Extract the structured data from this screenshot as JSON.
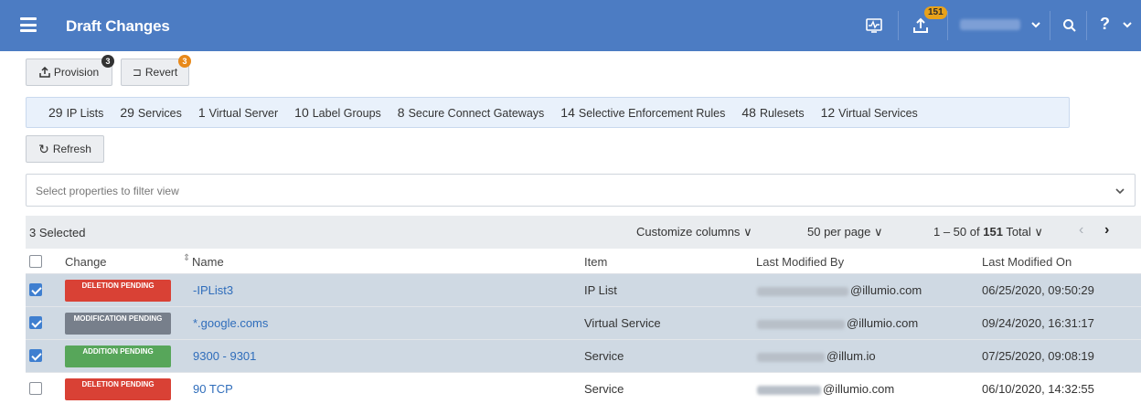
{
  "header": {
    "title": "Draft Changes",
    "pending_badge": "151",
    "icons": [
      "menu-icon",
      "monitor-icon",
      "upload-icon",
      "chevron-down-icon",
      "search-icon",
      "help-icon"
    ]
  },
  "actions": {
    "provision_label": "Provision",
    "provision_count": "3",
    "revert_label": "Revert",
    "revert_count": "3",
    "refresh_label": "Refresh"
  },
  "counts": [
    {
      "num": "29",
      "label": "IP Lists"
    },
    {
      "num": "29",
      "label": "Services"
    },
    {
      "num": "1",
      "label": "Virtual Server"
    },
    {
      "num": "10",
      "label": "Label Groups"
    },
    {
      "num": "8",
      "label": "Secure Connect Gateways"
    },
    {
      "num": "14",
      "label": "Selective Enforcement Rules"
    },
    {
      "num": "48",
      "label": "Rulesets"
    },
    {
      "num": "12",
      "label": "Virtual Services"
    }
  ],
  "filter": {
    "placeholder": "Select properties to filter view"
  },
  "toolbar": {
    "selected": "3 Selected",
    "customize": "Customize columns",
    "per_page": "50 per page",
    "range": "1 – 50 of",
    "total": "151",
    "total_label": "Total"
  },
  "table": {
    "columns": [
      "Change",
      "Name",
      "Item",
      "Last Modified By",
      "Last Modified On"
    ],
    "rows": [
      {
        "change": "DELETION PENDING",
        "status_color": "#d94135",
        "name": "-IPList3",
        "item": "IP List",
        "by_domain": "@illumio.com",
        "on": "06/25/2020, 09:50:29",
        "selected": true
      },
      {
        "change": "MODIFICATION PENDING",
        "status_color": "#777f8b",
        "name": "*.google.coms",
        "item": "Virtual Service",
        "by_domain": "@illumio.com",
        "on": "09/24/2020, 16:31:17",
        "selected": true
      },
      {
        "change": "ADDITION PENDING",
        "status_color": "#57a65a",
        "name": "9300 - 9301",
        "item": "Service",
        "by_domain": "@illum.io",
        "on": "07/25/2020, 09:08:19",
        "selected": true
      },
      {
        "change": "DELETION PENDING",
        "status_color": "#d94135",
        "name": "90 TCP",
        "item": "Service",
        "by_domain": "@illumio.com",
        "on": "06/10/2020, 14:32:55",
        "selected": false
      }
    ]
  },
  "colors": {
    "header_bg": "#4c7cc3",
    "link": "#2f6dbb",
    "selected_row": "#cfd9e3",
    "badge_orange": "#e8a21a"
  }
}
